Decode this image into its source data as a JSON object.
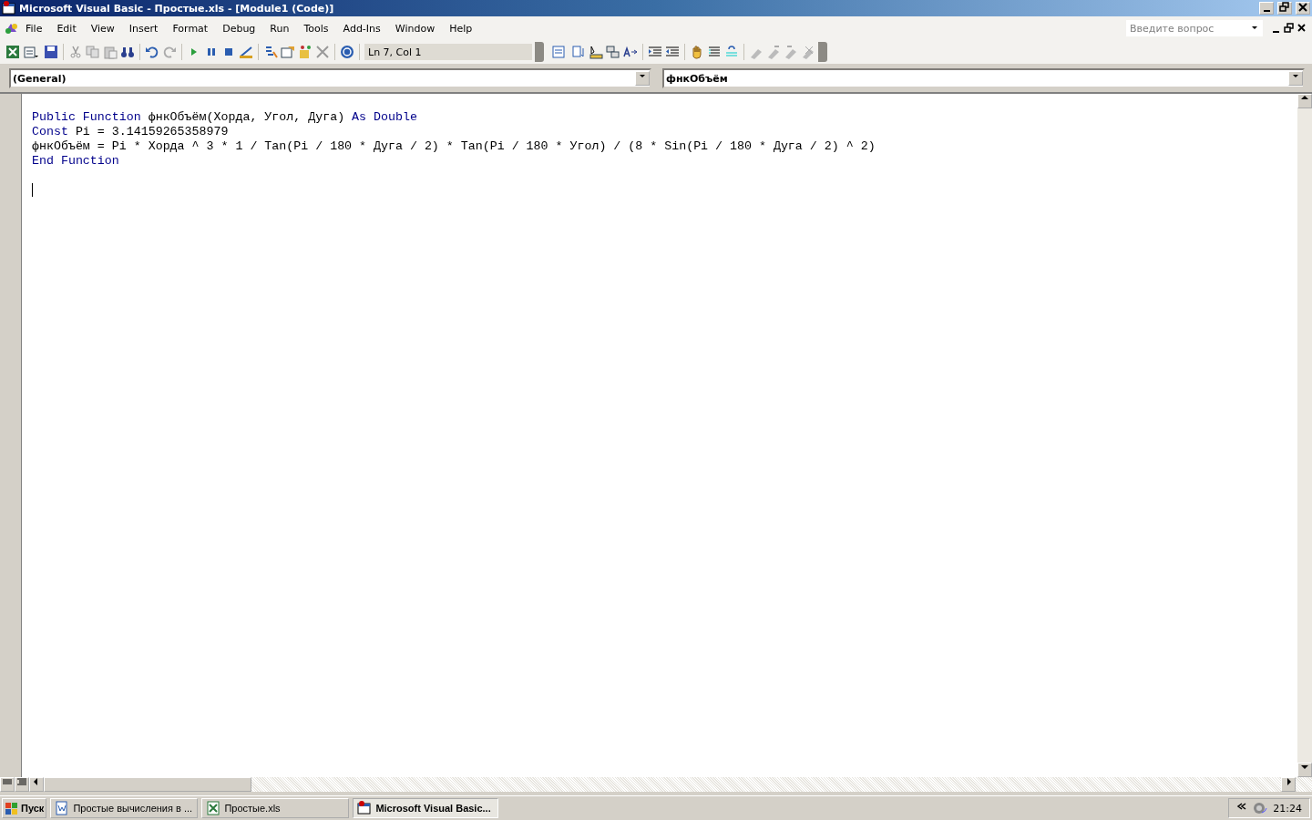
{
  "window": {
    "title": "Microsoft Visual Basic - Простые.xls - [Module1 (Code)]"
  },
  "menu": [
    {
      "label": "File"
    },
    {
      "label": "Edit"
    },
    {
      "label": "View"
    },
    {
      "label": "Insert"
    },
    {
      "label": "Format"
    },
    {
      "label": "Debug"
    },
    {
      "label": "Run"
    },
    {
      "label": "Tools"
    },
    {
      "label": "Add-Ins"
    },
    {
      "label": "Window"
    },
    {
      "label": "Help"
    }
  ],
  "help_search": {
    "placeholder": "Введите вопрос"
  },
  "toolbar": {
    "position": "Ln 7, Col 1"
  },
  "object_dropdown": {
    "value": "(General)"
  },
  "procedure_dropdown": {
    "value": "фнкОбъём"
  },
  "code_lines": [
    [
      {
        "kind": "keyword",
        "text": "Public Function"
      },
      {
        "kind": "plain",
        "text": " фнкОбъём(Хорда, Угол, Дуга) "
      },
      {
        "kind": "keyword",
        "text": "As Double"
      }
    ],
    [
      {
        "kind": "keyword",
        "text": "Const"
      },
      {
        "kind": "plain",
        "text": " Pi = 3.14159265358979"
      }
    ],
    [
      {
        "kind": "plain",
        "text": "фнкОбъём = Pi * Хорда ^ 3 * 1 / Tan(Pi / 180 * Дуга / 2) * Tan(Pi / 180 * Угол) / (8 * Sin(Pi / 180 * Дуга / 2) ^ 2)"
      }
    ],
    [
      {
        "kind": "keyword",
        "text": "End Function"
      }
    ]
  ],
  "taskbar": {
    "start": "Пуск",
    "tasks": [
      {
        "label": "Простые вычисления в ...",
        "kind": "word",
        "selected": false
      },
      {
        "label": "Простые.xls",
        "kind": "excel",
        "selected": false
      },
      {
        "label": "Microsoft Visual Basic...",
        "kind": "vb",
        "selected": true
      }
    ],
    "clock": "21:24"
  }
}
